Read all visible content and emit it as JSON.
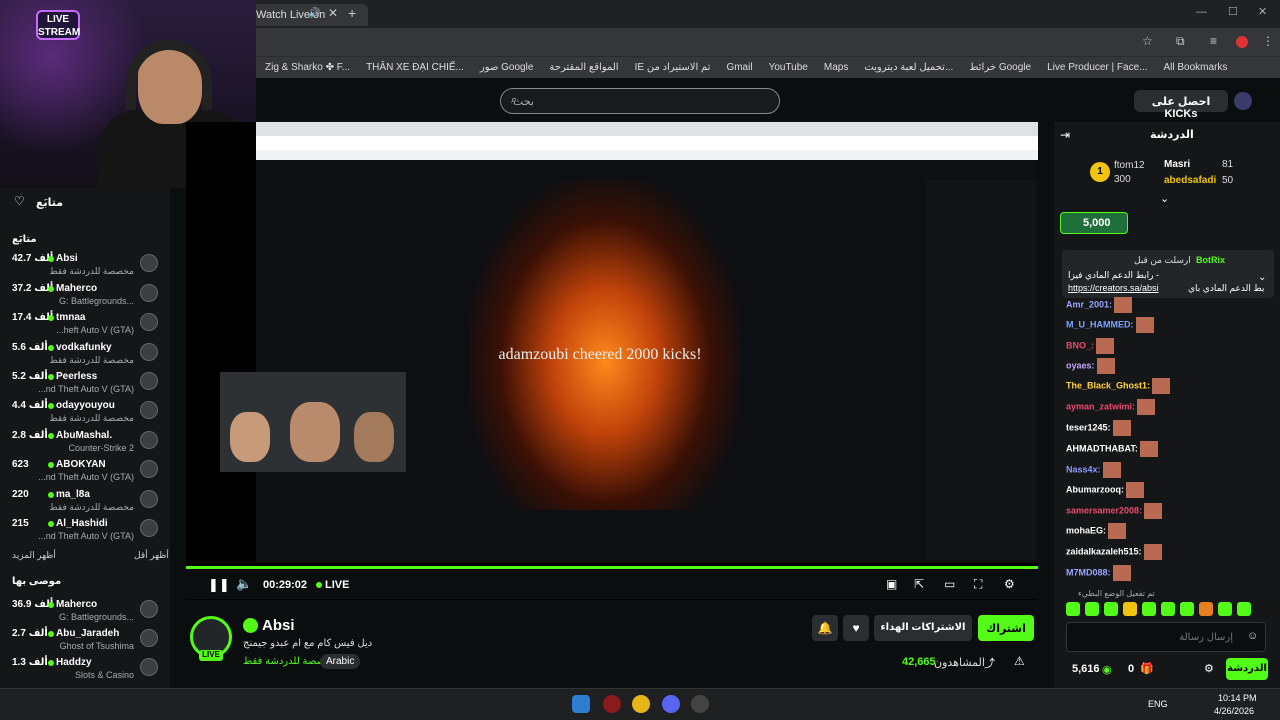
{
  "browser": {
    "tab_title": "Watch Live on",
    "bookmarks": [
      "Zig & Sharko ✤ F...",
      "THÂN XE ĐẠI CHIẾ...",
      "صور Google",
      "المواقع المقترحة",
      "IE تم الاستيراد من",
      "Gmail",
      "YouTube",
      "Maps",
      "تحميل لعبة ديترويت...",
      "خرائط Google",
      "Live Producer | Face...",
      "All Bookmarks"
    ]
  },
  "header": {
    "search_placeholder": "بحث",
    "get_kicks": "احصل على KICKs"
  },
  "webcam": {
    "badge": "LIVE STREAM"
  },
  "sidebar": {
    "following_title": "متابَع",
    "section_label": "متابَع",
    "channels": [
      {
        "name": "Absi",
        "viewers": "42.7 ألف",
        "category": "مخصصة للدردشة فقط"
      },
      {
        "name": "Maherco",
        "viewers": "37.2 ألف",
        "category": "G: Battlegrounds..."
      },
      {
        "name": "tmnaa",
        "viewers": "17.4 ألف",
        "category": "...heft Auto V (GTA)"
      },
      {
        "name": "vodkafunky",
        "viewers": "5.6 ألف",
        "category": "مخصصة للدردشة فقط"
      },
      {
        "name": "Peerless",
        "viewers": "5.2 ألف",
        "category": "...nd Theft Auto V (GTA)"
      },
      {
        "name": "odayyouyou",
        "viewers": "4.4 ألف",
        "category": "مخصصة للدردشة فقط"
      },
      {
        "name": "AbuMashal.",
        "viewers": "2.8 ألف",
        "category": "Counter-Strike 2"
      },
      {
        "name": "ABOKYAN",
        "viewers": "623",
        "category": "...nd Theft Auto V (GTA)"
      },
      {
        "name": "ma_l8a",
        "viewers": "220",
        "category": "مخصصة للدردشة فقط"
      },
      {
        "name": "Al_Hashidi",
        "viewers": "215",
        "category": "...nd Theft Auto V (GTA)"
      }
    ],
    "show_more": "أظهر المزيد",
    "show_less": "أظهر أقل",
    "recommended_title": "موصى بها",
    "recommended": [
      {
        "name": "Maherco",
        "viewers": "36.9 ألف",
        "category": "G: Battlegrounds..."
      },
      {
        "name": "Abu_Jaradeh",
        "viewers": "2.7 ألف",
        "category": "Ghost of Tsushima"
      },
      {
        "name": "Haddzy",
        "viewers": "1.3 ألف",
        "category": "Slots & Casino"
      }
    ]
  },
  "player": {
    "overlay_text": "adamzoubi cheered 2000 kicks!",
    "time": "00:29:02",
    "live_label": "LIVE"
  },
  "channel": {
    "name": "Absi",
    "live_badge": "LIVE",
    "title": "ديل فيس كام مع ام عبدو جيمنج",
    "category": "مخصصة للدردشة فقط",
    "tag": "Arabic",
    "viewers_label": "المشاهدون",
    "viewers": "42,665",
    "follow": "اشتراك",
    "gift_subs": "الاشتراكات الهداء"
  },
  "chat": {
    "title": "الدردشة",
    "leaders": [
      {
        "name": "ftom12",
        "value": "300"
      },
      {
        "name": "Masri",
        "value": "81"
      },
      {
        "name": "abedsafadi",
        "value": "50"
      }
    ],
    "kicks_pill": "5,000",
    "pinned_by": "ارسلت من قبل",
    "pinned_user": "BotRix",
    "pinned_text": "رابط الدعم المادي فيزا -",
    "pinned_link": "https://creators.sa/absi",
    "pinned_tail": "بط الدعم المادي باي",
    "messages": [
      {
        "user": "Amr_2001:",
        "color": "#9aa7ff"
      },
      {
        "user": "M_U_HAMMED:",
        "color": "#7ea3ff"
      },
      {
        "user": "BNO_:",
        "color": "#e94b6e"
      },
      {
        "user": "oyaes:",
        "color": "#c7a3ff"
      },
      {
        "user": "The_Black_Ghost1:",
        "color": "#ffd23f"
      },
      {
        "user": "ayman_zatwimi:",
        "color": "#e94b6e"
      },
      {
        "user": "teser1245:",
        "color": "#ffffff"
      },
      {
        "user": "AHMADTHABAT:",
        "color": "#ffffff"
      },
      {
        "user": "Nass4x:",
        "color": "#8b9cff"
      },
      {
        "user": "Abumarzooq:",
        "color": "#ffffff"
      },
      {
        "user": "samersamer2008:",
        "color": "#e94b6e"
      },
      {
        "user": "mohaEG:",
        "color": "#ffffff"
      },
      {
        "user": "zaidalkazaleh515:",
        "color": "#ffffff"
      },
      {
        "user": "M7MD088:",
        "color": "#9aa7ff"
      }
    ],
    "system_note": "تم تفعيل الوضع البطيء",
    "input_placeholder": "إرسال رسالة",
    "kick_balance": "5,616",
    "zero": "0",
    "send_button": "الدردشة"
  },
  "taskbar": {
    "lang": "ENG",
    "time": "10:14 PM",
    "date": "4/26/2026"
  },
  "colors": {
    "accent": "#53fc18",
    "background": "#0b0e0f",
    "panel": "#141618"
  }
}
